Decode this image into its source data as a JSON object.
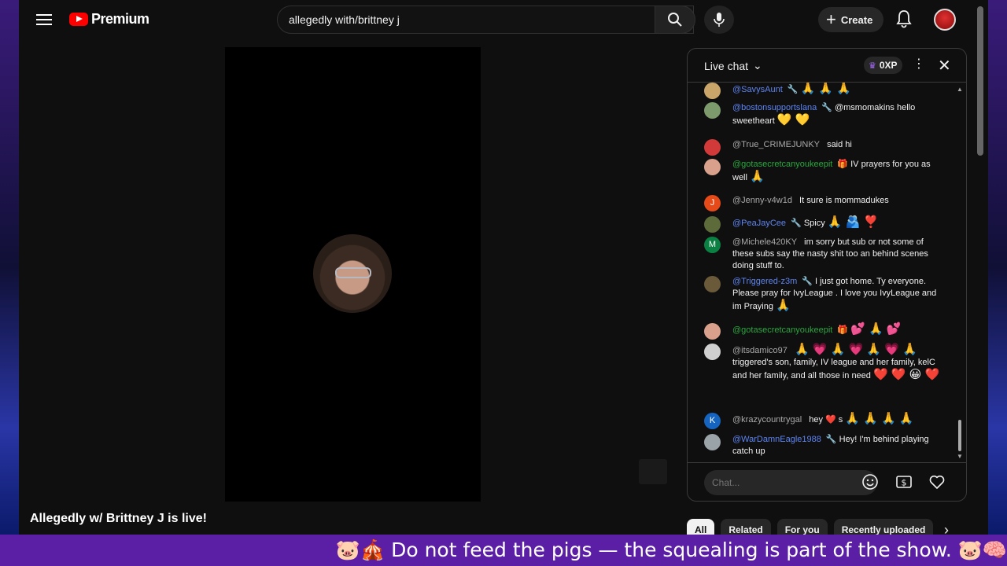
{
  "app": {
    "logo_label": "Premium"
  },
  "search": {
    "value": "allegedly with/brittney j",
    "clear_glyph": "✕"
  },
  "header": {
    "create_label": "Create",
    "create_glyph": "+"
  },
  "video": {
    "title": "Allegedly w/ Brittney J is live!"
  },
  "chips": [
    {
      "label": "All"
    },
    {
      "label": "Related"
    },
    {
      "label": "For you"
    },
    {
      "label": "Recently uploaded"
    }
  ],
  "chips_next_glyph": "›",
  "chat": {
    "title": "Live chat",
    "title_chevron": "⌄",
    "xp": "0XP",
    "crown_glyph": "♛",
    "kebab_glyph": "⋮",
    "close_glyph": "✕",
    "input_placeholder": "Chat...",
    "messages": [
      {
        "author": "@SavysAunt",
        "role": "mod",
        "tail": "🔧",
        "text": "",
        "emoji": "🙏 🙏 🙏",
        "avatar_color": "#c9a56a",
        "avatar_letter": ""
      },
      {
        "author": "@bostonsupportslana",
        "role": "mod",
        "tail": "🔧",
        "text": "@msmomakins hello sweetheart",
        "emoji": "💛 💛",
        "avatar_color": "#7c9a6b",
        "avatar_letter": ""
      },
      {
        "author": "@True_CRIMEJUNKY",
        "role": "",
        "tail": "",
        "text": "said hi",
        "emoji": "",
        "avatar_color": "#d23a3a",
        "avatar_letter": ""
      },
      {
        "author": "@gotasecretcanyoukeepit",
        "role": "member",
        "tail": "🎁",
        "text": "IV prayers for you as well",
        "emoji": "🙏",
        "avatar_color": "#d9a08b",
        "avatar_letter": ""
      },
      {
        "author": "@Jenny-v4w1d",
        "role": "",
        "tail": "",
        "text": "It sure is mommadukes",
        "emoji": "",
        "avatar_color": "#e64a19",
        "avatar_letter": "J"
      },
      {
        "author": "@PeaJayCee",
        "role": "mod",
        "tail": "🔧",
        "text": "Spicy",
        "emoji": "🙏 🫂 ❣️",
        "avatar_color": "#5d6b3a",
        "avatar_letter": ""
      },
      {
        "author": "@Michele420KY",
        "role": "",
        "tail": "",
        "text": "im sorry but sub or not some of these subs say the nasty shit too an behind scenes doing stuff to.",
        "emoji": "",
        "avatar_color": "#0b8043",
        "avatar_letter": "M"
      },
      {
        "author": "@Triggered-z3m",
        "role": "mod",
        "tail": "🔧",
        "text": "I just got home. Ty everyone. Please pray for IvyLeague . I love you IvyLeague and im Praying",
        "emoji": "🙏",
        "avatar_color": "#6b5a3a",
        "avatar_letter": ""
      },
      {
        "author": "@gotasecretcanyoukeepit",
        "role": "member",
        "tail": "🎁",
        "text": "",
        "emoji": "💕 🙏 💕",
        "avatar_color": "#d9a08b",
        "avatar_letter": ""
      },
      {
        "author": "@itsdamico97",
        "role": "",
        "tail": "",
        "text": "triggered's son, family, IV league and her family, kelC and her family, and all those in need",
        "emoji": "🙏 💗 🙏 💗 🙏 💗 🙏",
        "emoji_after": "❤️ ❤️ 😀 ❤️",
        "avatar_color": "#cfcfcf",
        "avatar_letter": ""
      },
      {
        "author": "@krazycountrygal",
        "role": "",
        "tail": "",
        "text": "hey ❤️ s",
        "emoji": "🙏 🙏 🙏 🙏",
        "avatar_color": "#1565c0",
        "avatar_letter": "K"
      },
      {
        "author": "@WarDamnEagle1988",
        "role": "mod",
        "tail": "🔧",
        "text": "Hey! I'm behind playing catch up",
        "emoji": "",
        "avatar_color": "#9aa3a8",
        "avatar_letter": ""
      }
    ]
  },
  "ticker": {
    "text": "🐷🎪 Do not feed the pigs — the squealing is part of the show. 🐷🧠"
  },
  "icons": {
    "menu": "hamburger-icon",
    "search": "search-icon",
    "mic": "microphone-icon",
    "bell": "bell-icon",
    "emoji": "smiley-icon",
    "super_chat": "dollar-chat-icon",
    "heart": "heart-icon"
  }
}
